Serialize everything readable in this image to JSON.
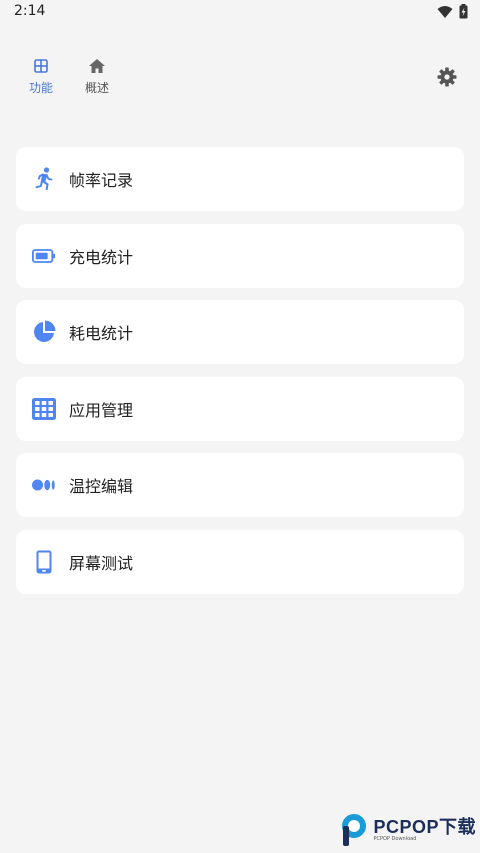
{
  "status_bar": {
    "time": "2:14"
  },
  "nav": {
    "tabs": [
      {
        "label": "功能",
        "icon": "grid-icon",
        "active": true
      },
      {
        "label": "概述",
        "icon": "home-icon",
        "active": false
      }
    ],
    "settings_icon": "gear-icon"
  },
  "menu": {
    "items": [
      {
        "label": "帧率记录",
        "icon": "running-icon"
      },
      {
        "label": "充电统计",
        "icon": "battery-icon"
      },
      {
        "label": "耗电统计",
        "icon": "pie-chart-icon"
      },
      {
        "label": "应用管理",
        "icon": "apps-grid-icon"
      },
      {
        "label": "温控编辑",
        "icon": "toggle-dots-icon"
      },
      {
        "label": "屏幕测试",
        "icon": "phone-icon"
      }
    ]
  },
  "watermark": {
    "text": "PCPOP下载",
    "sub": "PCPOP Download"
  },
  "colors": {
    "accent": "#4a78d6",
    "icon_blue": "#4f86f0",
    "background": "#f4f4f4",
    "card": "#ffffff"
  }
}
